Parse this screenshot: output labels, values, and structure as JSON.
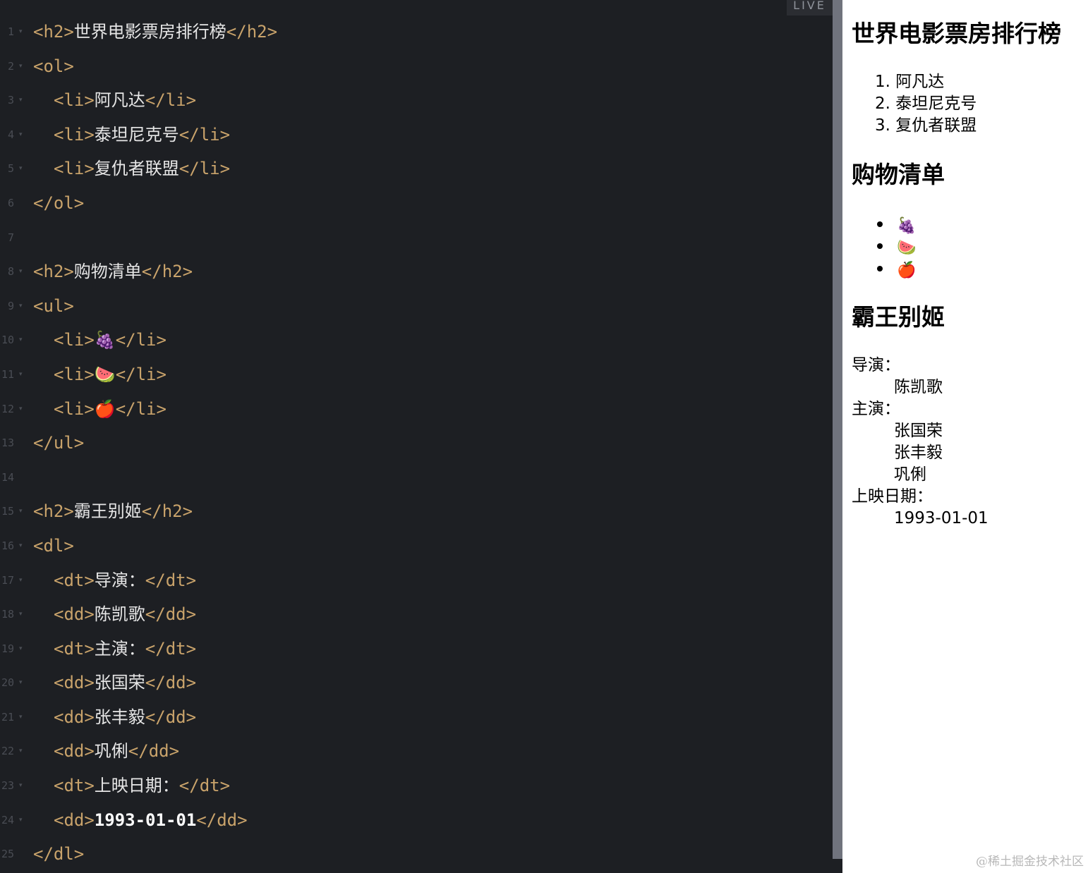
{
  "editor": {
    "live_label": "LIVE",
    "lines": [
      {
        "n": "1",
        "fold": true,
        "indent": false,
        "tokens": [
          {
            "t": "tag",
            "v": "<h2>"
          },
          {
            "t": "text",
            "v": "世界电影票房排行榜"
          },
          {
            "t": "tag",
            "v": "</h2>"
          }
        ]
      },
      {
        "n": "2",
        "fold": true,
        "indent": false,
        "tokens": [
          {
            "t": "tag",
            "v": "<ol>"
          }
        ]
      },
      {
        "n": "3",
        "fold": true,
        "indent": true,
        "tokens": [
          {
            "t": "tag",
            "v": "<li>"
          },
          {
            "t": "text",
            "v": "阿凡达"
          },
          {
            "t": "tag",
            "v": "</li>"
          }
        ]
      },
      {
        "n": "4",
        "fold": true,
        "indent": true,
        "tokens": [
          {
            "t": "tag",
            "v": "<li>"
          },
          {
            "t": "text",
            "v": "泰坦尼克号"
          },
          {
            "t": "tag",
            "v": "</li>"
          }
        ]
      },
      {
        "n": "5",
        "fold": true,
        "indent": true,
        "tokens": [
          {
            "t": "tag",
            "v": "<li>"
          },
          {
            "t": "text",
            "v": "复仇者联盟"
          },
          {
            "t": "tag",
            "v": "</li>"
          }
        ]
      },
      {
        "n": "6",
        "fold": false,
        "indent": false,
        "tokens": [
          {
            "t": "tag",
            "v": "</ol>"
          }
        ]
      },
      {
        "n": "7",
        "fold": false,
        "indent": false,
        "tokens": []
      },
      {
        "n": "8",
        "fold": true,
        "indent": false,
        "tokens": [
          {
            "t": "tag",
            "v": "<h2>"
          },
          {
            "t": "text",
            "v": "购物清单"
          },
          {
            "t": "tag",
            "v": "</h2>"
          }
        ]
      },
      {
        "n": "9",
        "fold": true,
        "indent": false,
        "tokens": [
          {
            "t": "tag",
            "v": "<ul>"
          }
        ]
      },
      {
        "n": "10",
        "fold": true,
        "indent": true,
        "tokens": [
          {
            "t": "tag",
            "v": "<li>"
          },
          {
            "t": "text",
            "v": "🍇"
          },
          {
            "t": "tag",
            "v": "</li>"
          }
        ]
      },
      {
        "n": "11",
        "fold": true,
        "indent": true,
        "tokens": [
          {
            "t": "tag",
            "v": "<li>"
          },
          {
            "t": "text",
            "v": "🍉"
          },
          {
            "t": "tag",
            "v": "</li>"
          }
        ]
      },
      {
        "n": "12",
        "fold": true,
        "indent": true,
        "tokens": [
          {
            "t": "tag",
            "v": "<li>"
          },
          {
            "t": "text",
            "v": "🍎"
          },
          {
            "t": "tag",
            "v": "</li>"
          }
        ]
      },
      {
        "n": "13",
        "fold": false,
        "indent": false,
        "tokens": [
          {
            "t": "tag",
            "v": "</ul>"
          }
        ]
      },
      {
        "n": "14",
        "fold": false,
        "indent": false,
        "tokens": []
      },
      {
        "n": "15",
        "fold": true,
        "indent": false,
        "tokens": [
          {
            "t": "tag",
            "v": "<h2>"
          },
          {
            "t": "text",
            "v": "霸王别姬"
          },
          {
            "t": "tag",
            "v": "</h2>"
          }
        ]
      },
      {
        "n": "16",
        "fold": true,
        "indent": false,
        "tokens": [
          {
            "t": "tag",
            "v": "<dl>"
          }
        ]
      },
      {
        "n": "17",
        "fold": true,
        "indent": true,
        "tokens": [
          {
            "t": "tag",
            "v": "<dt>"
          },
          {
            "t": "text",
            "v": "导演："
          },
          {
            "t": "tag",
            "v": "</dt>"
          }
        ]
      },
      {
        "n": "18",
        "fold": true,
        "indent": true,
        "tokens": [
          {
            "t": "tag",
            "v": "<dd>"
          },
          {
            "t": "text",
            "v": "陈凯歌"
          },
          {
            "t": "tag",
            "v": "</dd>"
          }
        ]
      },
      {
        "n": "19",
        "fold": true,
        "indent": true,
        "tokens": [
          {
            "t": "tag",
            "v": "<dt>"
          },
          {
            "t": "text",
            "v": "主演："
          },
          {
            "t": "tag",
            "v": "</dt>"
          }
        ]
      },
      {
        "n": "20",
        "fold": true,
        "indent": true,
        "tokens": [
          {
            "t": "tag",
            "v": "<dd>"
          },
          {
            "t": "text",
            "v": "张国荣"
          },
          {
            "t": "tag",
            "v": "</dd>"
          }
        ]
      },
      {
        "n": "21",
        "fold": true,
        "indent": true,
        "tokens": [
          {
            "t": "tag",
            "v": "<dd>"
          },
          {
            "t": "text",
            "v": "张丰毅"
          },
          {
            "t": "tag",
            "v": "</dd>"
          }
        ]
      },
      {
        "n": "22",
        "fold": true,
        "indent": true,
        "tokens": [
          {
            "t": "tag",
            "v": "<dd>"
          },
          {
            "t": "text",
            "v": "巩俐"
          },
          {
            "t": "tag",
            "v": "</dd>"
          }
        ]
      },
      {
        "n": "23",
        "fold": true,
        "indent": true,
        "tokens": [
          {
            "t": "tag",
            "v": "<dt>"
          },
          {
            "t": "text",
            "v": "上映日期："
          },
          {
            "t": "tag",
            "v": "</dt>"
          }
        ]
      },
      {
        "n": "24",
        "fold": true,
        "indent": true,
        "tokens": [
          {
            "t": "tag",
            "v": "<dd>"
          },
          {
            "t": "num",
            "v": "1993-01-01"
          },
          {
            "t": "tag",
            "v": "</dd>"
          }
        ]
      },
      {
        "n": "25",
        "fold": false,
        "indent": false,
        "tokens": [
          {
            "t": "tag",
            "v": "</dl>"
          }
        ]
      }
    ]
  },
  "preview": {
    "movies_heading": "世界电影票房排行榜",
    "movies": [
      "阿凡达",
      "泰坦尼克号",
      "复仇者联盟"
    ],
    "shopping_heading": "购物清单",
    "shopping": [
      {
        "emoji": "🍇",
        "icon": "grapes-emoji-icon"
      },
      {
        "emoji": "🍉",
        "icon": "watermelon-emoji-icon"
      },
      {
        "emoji": "🍎",
        "icon": "apple-emoji-icon"
      }
    ],
    "film_heading": "霸王别姬",
    "director_label": "导演：",
    "director": "陈凯歌",
    "cast_label": "主演：",
    "cast": [
      "张国荣",
      "张丰毅",
      "巩俐"
    ],
    "release_label": "上映日期：",
    "release_date": "1993-01-01"
  },
  "watermark": "@稀土掘金技术社区",
  "colors": {
    "editor_bg": "#1d1f23",
    "tag": "#c9a36b",
    "text": "#e6e6e6",
    "line_number": "#4a4d54",
    "scrollbar": "#70737d",
    "preview_bg": "#ffffff"
  }
}
